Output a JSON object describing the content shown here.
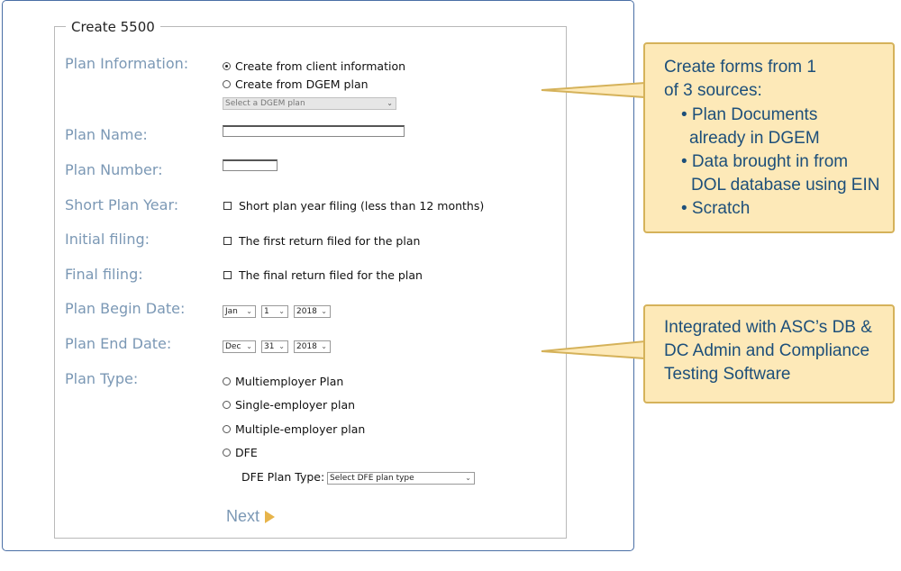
{
  "form": {
    "title": "Create 5500",
    "labels": {
      "plan_information": "Plan Information:",
      "plan_name": "Plan Name:",
      "plan_number": "Plan Number:",
      "short_plan_year": "Short Plan Year:",
      "initial_filing": "Initial filing:",
      "final_filing": "Final filing:",
      "plan_begin_date": "Plan Begin Date:",
      "plan_end_date": "Plan End Date:",
      "plan_type": "Plan Type:"
    },
    "plan_information": {
      "option_client": "Create from client information",
      "option_dgem": "Create from DGEM plan",
      "dgem_select": "Select a DGEM plan"
    },
    "plan_name_value": "",
    "plan_number_value": "",
    "short_plan_year_text": "Short plan year filing (less than 12 months)",
    "initial_filing_text": "The first return filed for the plan",
    "final_filing_text": "The final return filed for the plan",
    "begin_date": {
      "month": "Jan",
      "day": "1",
      "year": "2018"
    },
    "end_date": {
      "month": "Dec",
      "day": "31",
      "year": "2018"
    },
    "plan_types": [
      "Multiemployer Plan",
      "Single-employer plan",
      "Multiple-employer plan",
      "DFE"
    ],
    "dfe_plan_type_label": "DFE Plan Type:",
    "dfe_plan_type_select": "Select DFE plan type",
    "next_label": "Next"
  },
  "callouts": {
    "sources": {
      "line1": "Create forms from 1",
      "line2": "of 3 sources:",
      "bullet1a": "• Plan Documents",
      "bullet1b": "already in DGEM",
      "bullet2a": "• Data brought in from",
      "bullet2b": "DOL database using EIN",
      "bullet3": "• Scratch"
    },
    "integration": {
      "line1": "Integrated with ASC’s  DB &",
      "line2": "DC Admin and Compliance",
      "line3": "Testing Software"
    }
  },
  "colors": {
    "label": "#7b98b5",
    "callout_fill": "#fde9b8",
    "callout_border": "#d5b25a",
    "callout_text": "#1d4f7a",
    "next_arrow": "#e7b44a"
  }
}
